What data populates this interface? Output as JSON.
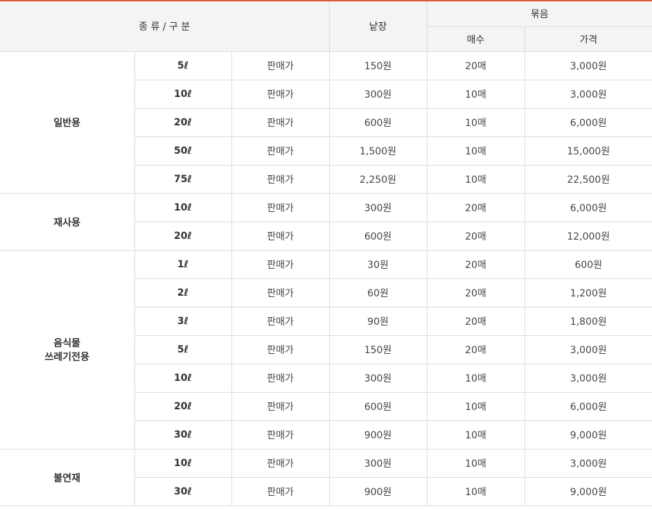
{
  "header": {
    "type": "종 류 / 구 분",
    "single": "낱장",
    "bundle": "묶음",
    "count": "매수",
    "price": "가격"
  },
  "groups": [
    {
      "name": "일반용",
      "rows": [
        {
          "size": "5ℓ",
          "label": "판매가",
          "single": "150원",
          "count": "20매",
          "price": "3,000원"
        },
        {
          "size": "10ℓ",
          "label": "판매가",
          "single": "300원",
          "count": "10매",
          "price": "3,000원"
        },
        {
          "size": "20ℓ",
          "label": "판매가",
          "single": "600원",
          "count": "10매",
          "price": "6,000원"
        },
        {
          "size": "50ℓ",
          "label": "판매가",
          "single": "1,500원",
          "count": "10매",
          "price": "15,000원"
        },
        {
          "size": "75ℓ",
          "label": "판매가",
          "single": "2,250원",
          "count": "10매",
          "price": "22,500원"
        }
      ]
    },
    {
      "name": "재사용",
      "rows": [
        {
          "size": "10ℓ",
          "label": "판매가",
          "single": "300원",
          "count": "20매",
          "price": "6,000원"
        },
        {
          "size": "20ℓ",
          "label": "판매가",
          "single": "600원",
          "count": "20매",
          "price": "12,000원"
        }
      ]
    },
    {
      "name": "음식물\n쓰레기전용",
      "rows": [
        {
          "size": "1ℓ",
          "label": "판매가",
          "single": "30원",
          "count": "20매",
          "price": "600원"
        },
        {
          "size": "2ℓ",
          "label": "판매가",
          "single": "60원",
          "count": "20매",
          "price": "1,200원"
        },
        {
          "size": "3ℓ",
          "label": "판매가",
          "single": "90원",
          "count": "20매",
          "price": "1,800원"
        },
        {
          "size": "5ℓ",
          "label": "판매가",
          "single": "150원",
          "count": "20매",
          "price": "3,000원"
        },
        {
          "size": "10ℓ",
          "label": "판매가",
          "single": "300원",
          "count": "10매",
          "price": "3,000원"
        },
        {
          "size": "20ℓ",
          "label": "판매가",
          "single": "600원",
          "count": "10매",
          "price": "6,000원"
        },
        {
          "size": "30ℓ",
          "label": "판매가",
          "single": "900원",
          "count": "10매",
          "price": "9,000원"
        }
      ]
    },
    {
      "name": "불연재",
      "rows": [
        {
          "size": "10ℓ",
          "label": "판매가",
          "single": "300원",
          "count": "10매",
          "price": "3,000원"
        },
        {
          "size": "30ℓ",
          "label": "판매가",
          "single": "900원",
          "count": "10매",
          "price": "9,000원"
        }
      ]
    }
  ]
}
